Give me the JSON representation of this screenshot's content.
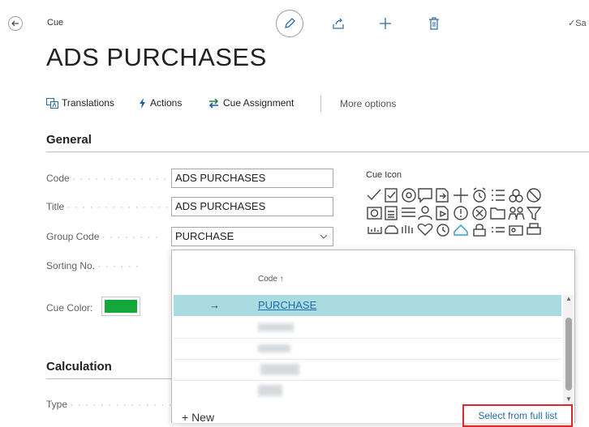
{
  "header": {
    "page_caption": "Cue",
    "save_status": "✓Sa"
  },
  "page_title": "ADS PURCHASES",
  "action_bar": {
    "translations": "Translations",
    "actions": "Actions",
    "cue_assignment": "Cue Assignment",
    "more_options": "More options"
  },
  "general": {
    "heading": "General",
    "code_label": "Code",
    "code_value": "ADS PURCHASES",
    "title_label": "Title",
    "title_value": "ADS PURCHASES",
    "group_code_label": "Group Code",
    "group_code_value": "PURCHASE",
    "sorting_no_label": "Sorting No.",
    "cue_color_label": "Cue Color:",
    "cue_color": "#14a83b",
    "cue_icon_label": "Cue Icon"
  },
  "calculation": {
    "heading": "Calculation",
    "type_label": "Type"
  },
  "dropdown": {
    "column_header": "Code ↑",
    "selected_row": "PURCHASE",
    "new_label": "+ New",
    "select_full_list": "Select from full list"
  }
}
